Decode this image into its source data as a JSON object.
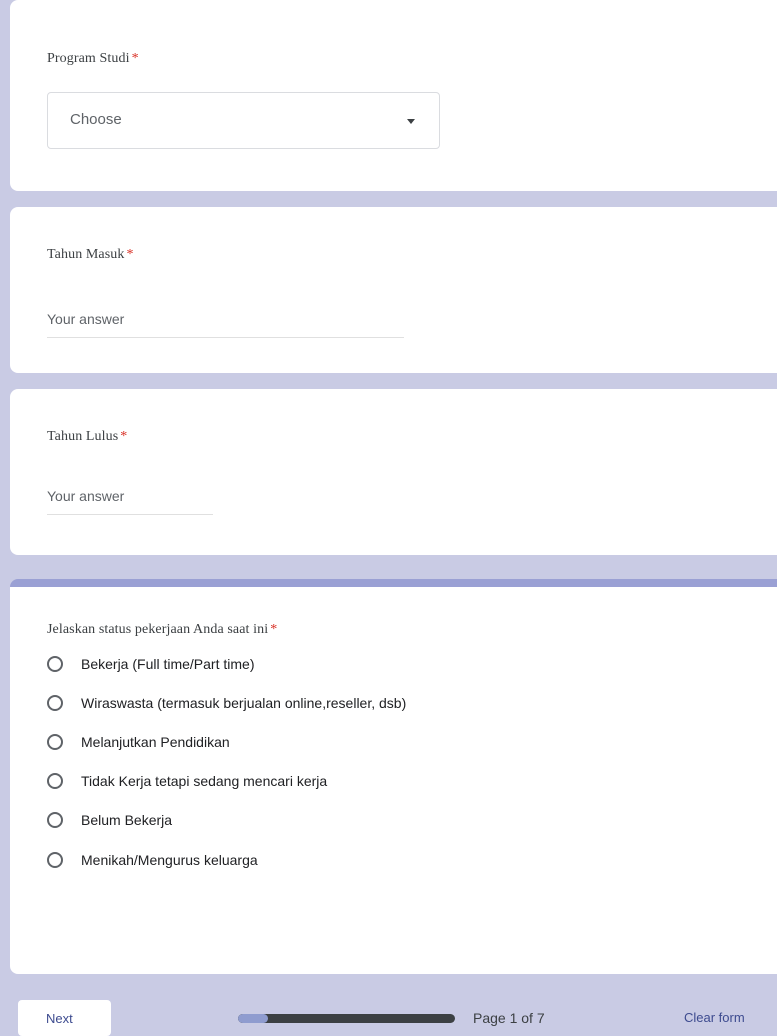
{
  "colors": {
    "background": "#c9cbe4",
    "card": "#ffffff",
    "required": "#d93025",
    "accent": "#3d4b8f",
    "progress_track": "#3c4043",
    "progress_fill": "#8f9ccf"
  },
  "questions": {
    "program_studi": {
      "title": "Program Studi",
      "required_mark": "*",
      "dropdown_value": "Choose"
    },
    "tahun_masuk": {
      "title": "Tahun Masuk",
      "required_mark": "*",
      "placeholder": "Your answer"
    },
    "tahun_lulus": {
      "title": "Tahun Lulus",
      "required_mark": "*",
      "placeholder": "Your answer"
    },
    "status_pekerjaan": {
      "title": "Jelaskan status pekerjaan Anda saat ini",
      "required_mark": "*",
      "options": [
        {
          "label": "Bekerja (Full time/Part time)"
        },
        {
          "label": "Wiraswasta (termasuk berjualan online,reseller, dsb)"
        },
        {
          "label": "Melanjutkan Pendidikan"
        },
        {
          "label": "Tidak Kerja tetapi sedang mencari kerja"
        },
        {
          "label": "Belum Bekerja"
        },
        {
          "label": "Menikah/Mengurus keluarga"
        }
      ]
    }
  },
  "footer": {
    "next_label": "Next",
    "progress_fraction": 0.14,
    "page_indicator": "Page 1 of 7",
    "clear_label": "Clear form"
  },
  "icons": {
    "dropdown": "chevron-down-icon",
    "option": "radio-icon"
  }
}
